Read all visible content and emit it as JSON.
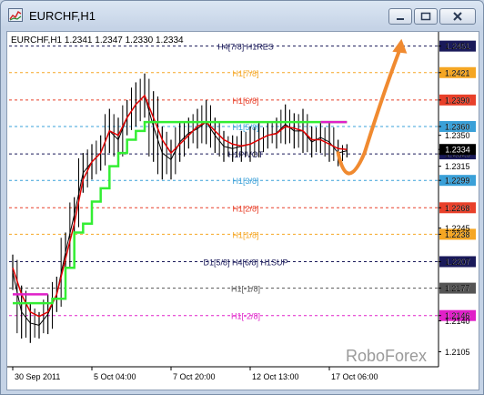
{
  "window": {
    "title": "EURCHF,H1",
    "buttons": [
      "minimize",
      "maximize",
      "close"
    ]
  },
  "chart_data": {
    "type": "line",
    "symbol_header": "EURCHF,H1  1.2341 1.2347 1.2330 1.2334",
    "watermark": "RoboForex",
    "ylim": [
      1.2088,
      1.2463
    ],
    "y_ticks": [
      "1.2451",
      "1.2421",
      "1.2390",
      "1.2360",
      "1.2350",
      "1.2334",
      "1.2329",
      "1.2315",
      "1.2299",
      "1.2268",
      "1.2245",
      "1.2238",
      "1.2207",
      "1.2177",
      "1.2146",
      "1.2140",
      "1.2105"
    ],
    "x_ticks": [
      "30 Sep 2011",
      "5 Oct 04:00",
      "7 Oct 20:00",
      "12 Oct 13:00",
      "17 Oct 06:00"
    ],
    "x_tick_index": [
      0,
      18,
      36,
      54,
      72
    ],
    "levels": [
      {
        "label": "H4[7/8] H1RES",
        "value": 1.2451,
        "color": "#1a1a5a",
        "badge": "1.2451"
      },
      {
        "label": "H1[7/8]",
        "value": 1.2421,
        "color": "#f5a623",
        "badge": "1.2421"
      },
      {
        "label": "H1[6/8]",
        "value": 1.239,
        "color": "#e8402a",
        "badge": "1.2390"
      },
      {
        "label": "H1[5/8]",
        "value": 1.236,
        "color": "#3aa0d8",
        "badge": "1.2360"
      },
      {
        "label": "H1PIVOT",
        "value": 1.2329,
        "color": "#1a1a5a",
        "badge": "1.2329"
      },
      {
        "label": "H1[3/8]",
        "value": 1.2299,
        "color": "#3aa0d8",
        "badge": "1.2299"
      },
      {
        "label": "H1[2/8]",
        "value": 1.2268,
        "color": "#e8402a",
        "badge": "1.2268"
      },
      {
        "label": "H1[1/8]",
        "value": 1.2238,
        "color": "#f5a623",
        "badge": "1.2238"
      },
      {
        "label": "D1[5/8] H4[6/8] H1SUP",
        "value": 1.2207,
        "color": "#1a1a5a",
        "badge": "1.2207"
      },
      {
        "label": "H1[-1/8]",
        "value": 1.2177,
        "color": "#555555",
        "badge": "1.2177"
      },
      {
        "label": "H1[-2/8]",
        "value": 1.2146,
        "color": "#e020c8",
        "badge": "1.2146"
      }
    ],
    "current_price": {
      "value": 1.2334,
      "label": "1.2334"
    },
    "price_series": {
      "name": "EURCHF H1",
      "x": [
        0,
        2,
        4,
        6,
        8,
        10,
        12,
        14,
        16,
        18,
        20,
        22,
        24,
        26,
        28,
        30,
        32,
        34,
        36,
        38,
        40,
        42,
        44,
        46,
        48,
        50,
        52,
        54,
        56,
        58,
        60,
        62,
        64,
        66,
        68,
        70,
        72,
        74,
        76
      ],
      "high": [
        1.2215,
        1.218,
        1.216,
        1.215,
        1.217,
        1.219,
        1.224,
        1.228,
        1.233,
        1.234,
        1.235,
        1.238,
        1.237,
        1.239,
        1.241,
        1.242,
        1.24,
        1.236,
        1.2345,
        1.2365,
        1.237,
        1.238,
        1.239,
        1.237,
        1.2355,
        1.235,
        1.2355,
        1.236,
        1.2365,
        1.2365,
        1.237,
        1.2385,
        1.2375,
        1.238,
        1.236,
        1.2365,
        1.2365,
        1.2345,
        1.234
      ],
      "low": [
        1.2175,
        1.212,
        1.2115,
        1.212,
        1.2125,
        1.215,
        1.2195,
        1.224,
        1.2285,
        1.23,
        1.231,
        1.233,
        1.232,
        1.235,
        1.236,
        1.237,
        1.232,
        1.23,
        1.23,
        1.232,
        1.2335,
        1.2335,
        1.234,
        1.233,
        1.232,
        1.232,
        1.232,
        1.232,
        1.2325,
        1.2335,
        1.2335,
        1.234,
        1.2335,
        1.233,
        1.2325,
        1.233,
        1.232,
        1.2315,
        1.2325
      ]
    },
    "red_line": {
      "x": [
        0,
        2,
        4,
        6,
        8,
        10,
        12,
        14,
        16,
        18,
        20,
        22,
        24,
        26,
        28,
        30,
        32,
        34,
        36,
        38,
        40,
        42,
        44,
        46,
        48,
        50,
        52,
        54,
        56,
        58,
        60,
        62,
        64,
        66,
        68,
        70,
        72,
        74,
        76
      ],
      "y": [
        1.22,
        1.217,
        1.215,
        1.2145,
        1.215,
        1.217,
        1.221,
        1.225,
        1.23,
        1.232,
        1.233,
        1.2355,
        1.235,
        1.237,
        1.2385,
        1.2395,
        1.237,
        1.2345,
        1.233,
        1.234,
        1.235,
        1.236,
        1.2365,
        1.2355,
        1.2345,
        1.234,
        1.2338,
        1.234,
        1.2345,
        1.235,
        1.2352,
        1.236,
        1.2358,
        1.2355,
        1.2345,
        1.2345,
        1.234,
        1.2335,
        1.2334
      ]
    },
    "green_step": {
      "x": [
        0,
        6,
        9,
        12,
        14,
        16,
        18,
        20,
        22,
        24,
        26,
        28,
        30,
        33,
        36,
        40,
        44,
        48,
        52,
        56,
        60,
        64,
        68,
        72,
        76
      ],
      "y": [
        1.216,
        1.216,
        1.2165,
        1.22,
        1.224,
        1.225,
        1.2275,
        1.229,
        1.2315,
        1.233,
        1.2345,
        1.2355,
        1.2365,
        1.2365,
        1.2365,
        1.2365,
        1.2365,
        1.2365,
        1.2365,
        1.2365,
        1.2365,
        1.2365,
        1.2365,
        1.2365,
        1.2365
      ]
    },
    "magenta_segments": [
      {
        "x": [
          0,
          8
        ],
        "y": [
          1.217,
          1.217
        ]
      },
      {
        "x": [
          70,
          76
        ],
        "y": [
          1.2365,
          1.2365
        ]
      }
    ],
    "forecast_arrow": {
      "x": [
        74,
        76,
        80,
        84,
        88
      ],
      "y": [
        1.233,
        1.2298,
        1.233,
        1.24,
        1.2455
      ]
    },
    "x_max": 96,
    "colors": {
      "price": "#000000",
      "red": "#e10000",
      "green": "#33ee33",
      "magenta": "#e020c8",
      "arrow": "#f08a30",
      "current_badge": "#000000"
    }
  }
}
